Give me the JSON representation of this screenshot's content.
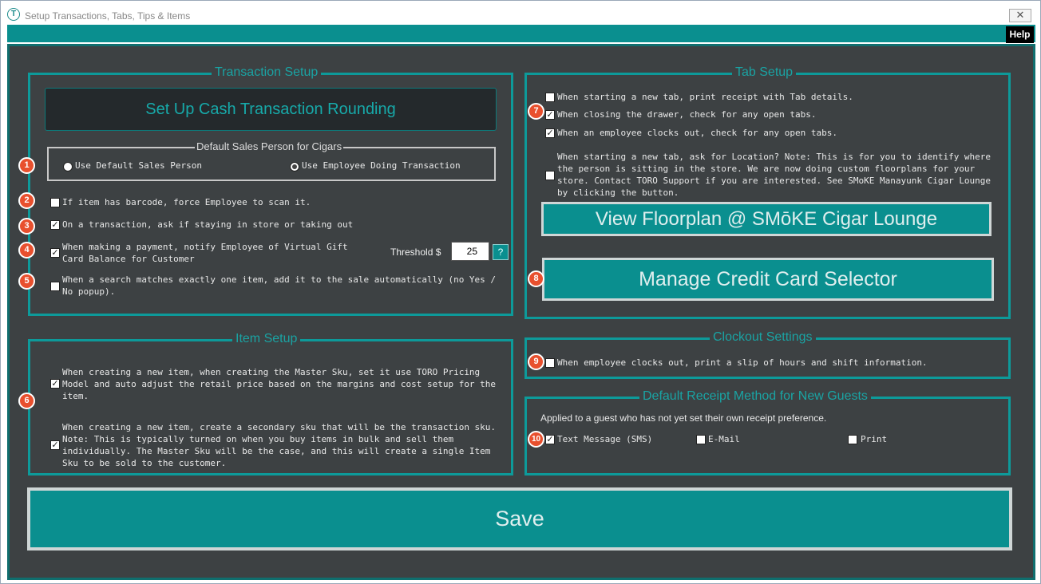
{
  "window": {
    "title": "Setup Transactions, Tabs, Tips & Items",
    "close": "✕",
    "app_icon_letter": "T",
    "help": "Help"
  },
  "transaction": {
    "title": "Transaction Setup",
    "rounding_button": "Set Up Cash Transaction Rounding",
    "sales_person": {
      "title": "Default Sales Person for Cigars",
      "option_default": "Use Default Sales Person",
      "option_employee": "Use Employee Doing Transaction",
      "selected": "Use Employee Doing Transaction"
    },
    "barcode": "If item has barcode, force Employee to scan it.",
    "staying": "On a transaction, ask if staying in store or taking out",
    "gift_card": "When making a payment, notify Employee of Virtual Gift Card Balance for Customer",
    "threshold_label": "Threshold $",
    "threshold_value": "25",
    "threshold_help": "?",
    "search_match": "When a search matches exactly one item, add it to the sale automatically (no Yes / No popup)."
  },
  "item": {
    "title": "Item Setup",
    "master_sku": "When creating a new item, when creating the Master Sku, set it use TORO Pricing Model and auto adjust the retail price based on the margins and cost setup for the item.",
    "secondary_sku": "When creating a new item, create a secondary sku that will be the transaction sku. Note: This is typically turned on when you buy items in bulk and sell them individually. The Master Sku will be the case, and this will create a single Item Sku to be sold to the customer."
  },
  "tab": {
    "title": "Tab Setup",
    "print_receipt": "When starting a new tab, print receipt with Tab details.",
    "closing_drawer": "When closing the drawer, check for any open tabs.",
    "clocks_out": "When an employee clocks out, check for any open tabs.",
    "location": "When starting a new tab, ask for Location? Note: This is for you to identify where the person is sitting in the store. We are now doing custom floorplans for your store. Contact TORO Support if you are interested. See SMoKE Manayunk Cigar Lounge by clicking the button.",
    "floorplan_button": "View Floorplan @ SMōKE Cigar Lounge",
    "credit_card_button": "Manage Credit Card Selector"
  },
  "clockout": {
    "title": "Clockout Settings",
    "print_slip": "When employee clocks out, print a slip of hours and shift information."
  },
  "receipt": {
    "title": "Default Receipt Method for New Guests",
    "description": "Applied to a guest who has not yet set their own receipt preference.",
    "sms": "Text Message (SMS)",
    "email": "E-Mail",
    "print": "Print"
  },
  "save": "Save",
  "badges": [
    "1",
    "2",
    "3",
    "4",
    "5",
    "6",
    "7",
    "8",
    "9",
    "10"
  ],
  "check_mark": "✓",
  "colors": {
    "panel": "#3d4143",
    "teal": "#0a8f8f",
    "badge": "#e8502e",
    "title_teal": "#1aa3a3"
  }
}
